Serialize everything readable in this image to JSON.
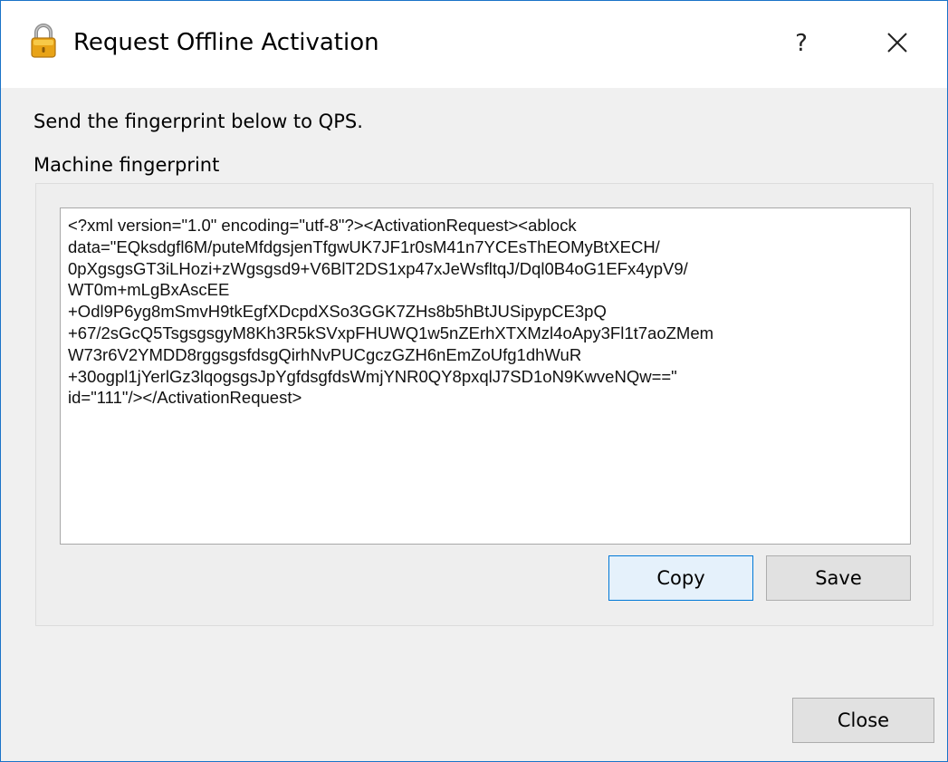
{
  "window": {
    "title": "Request Offline Activation",
    "help_label": "?",
    "icon": "lock-icon",
    "accent_color": "#0078d7"
  },
  "content": {
    "intro_text": "Send the fingerprint below to QPS.",
    "fingerprint_label": "Machine fingerprint",
    "fingerprint_lines": [
      "<?xml version=\"1.0\" encoding=\"utf-8\"?><ActivationRequest><ablock",
      "data=\"EQksdgfl6M/puteMfdgsjenTfgwUK7JF1r0sM41n7YCEsThEOMyBtXECH/",
      "0pXgsgsGT3iLHozi+zWgsgsd9+V6BlT2DS1xp47xJeWsfltqJ/Dql0B4oG1EFx4ypV9/",
      "WT0m+mLgBxAscEE",
      "+Odl9P6yg8mSmvH9tkEgfXDcpdXSo3GGK7ZHs8b5hBtJUSipypCE3pQ",
      "+67/2sGcQ5TsgsgsgyM8Kh3R5kSVxpFHUWQ1w5nZErhXTXMzl4oApy3Fl1t7aoZMem",
      "W73r6V2YMDD8rggsgsfdsgQirhNvPUCgczGZH6nEmZoUfg1dhWuR",
      "+30ogpl1jYerlGz3lqogsgsJpYgfdsgfdsWmjYNR0QY8pxqlJ7SD1oN9KwveNQw==\"",
      "id=\"111\"/></ActivationRequest>"
    ]
  },
  "buttons": {
    "copy_label": "Copy",
    "save_label": "Save",
    "close_label": "Close"
  }
}
